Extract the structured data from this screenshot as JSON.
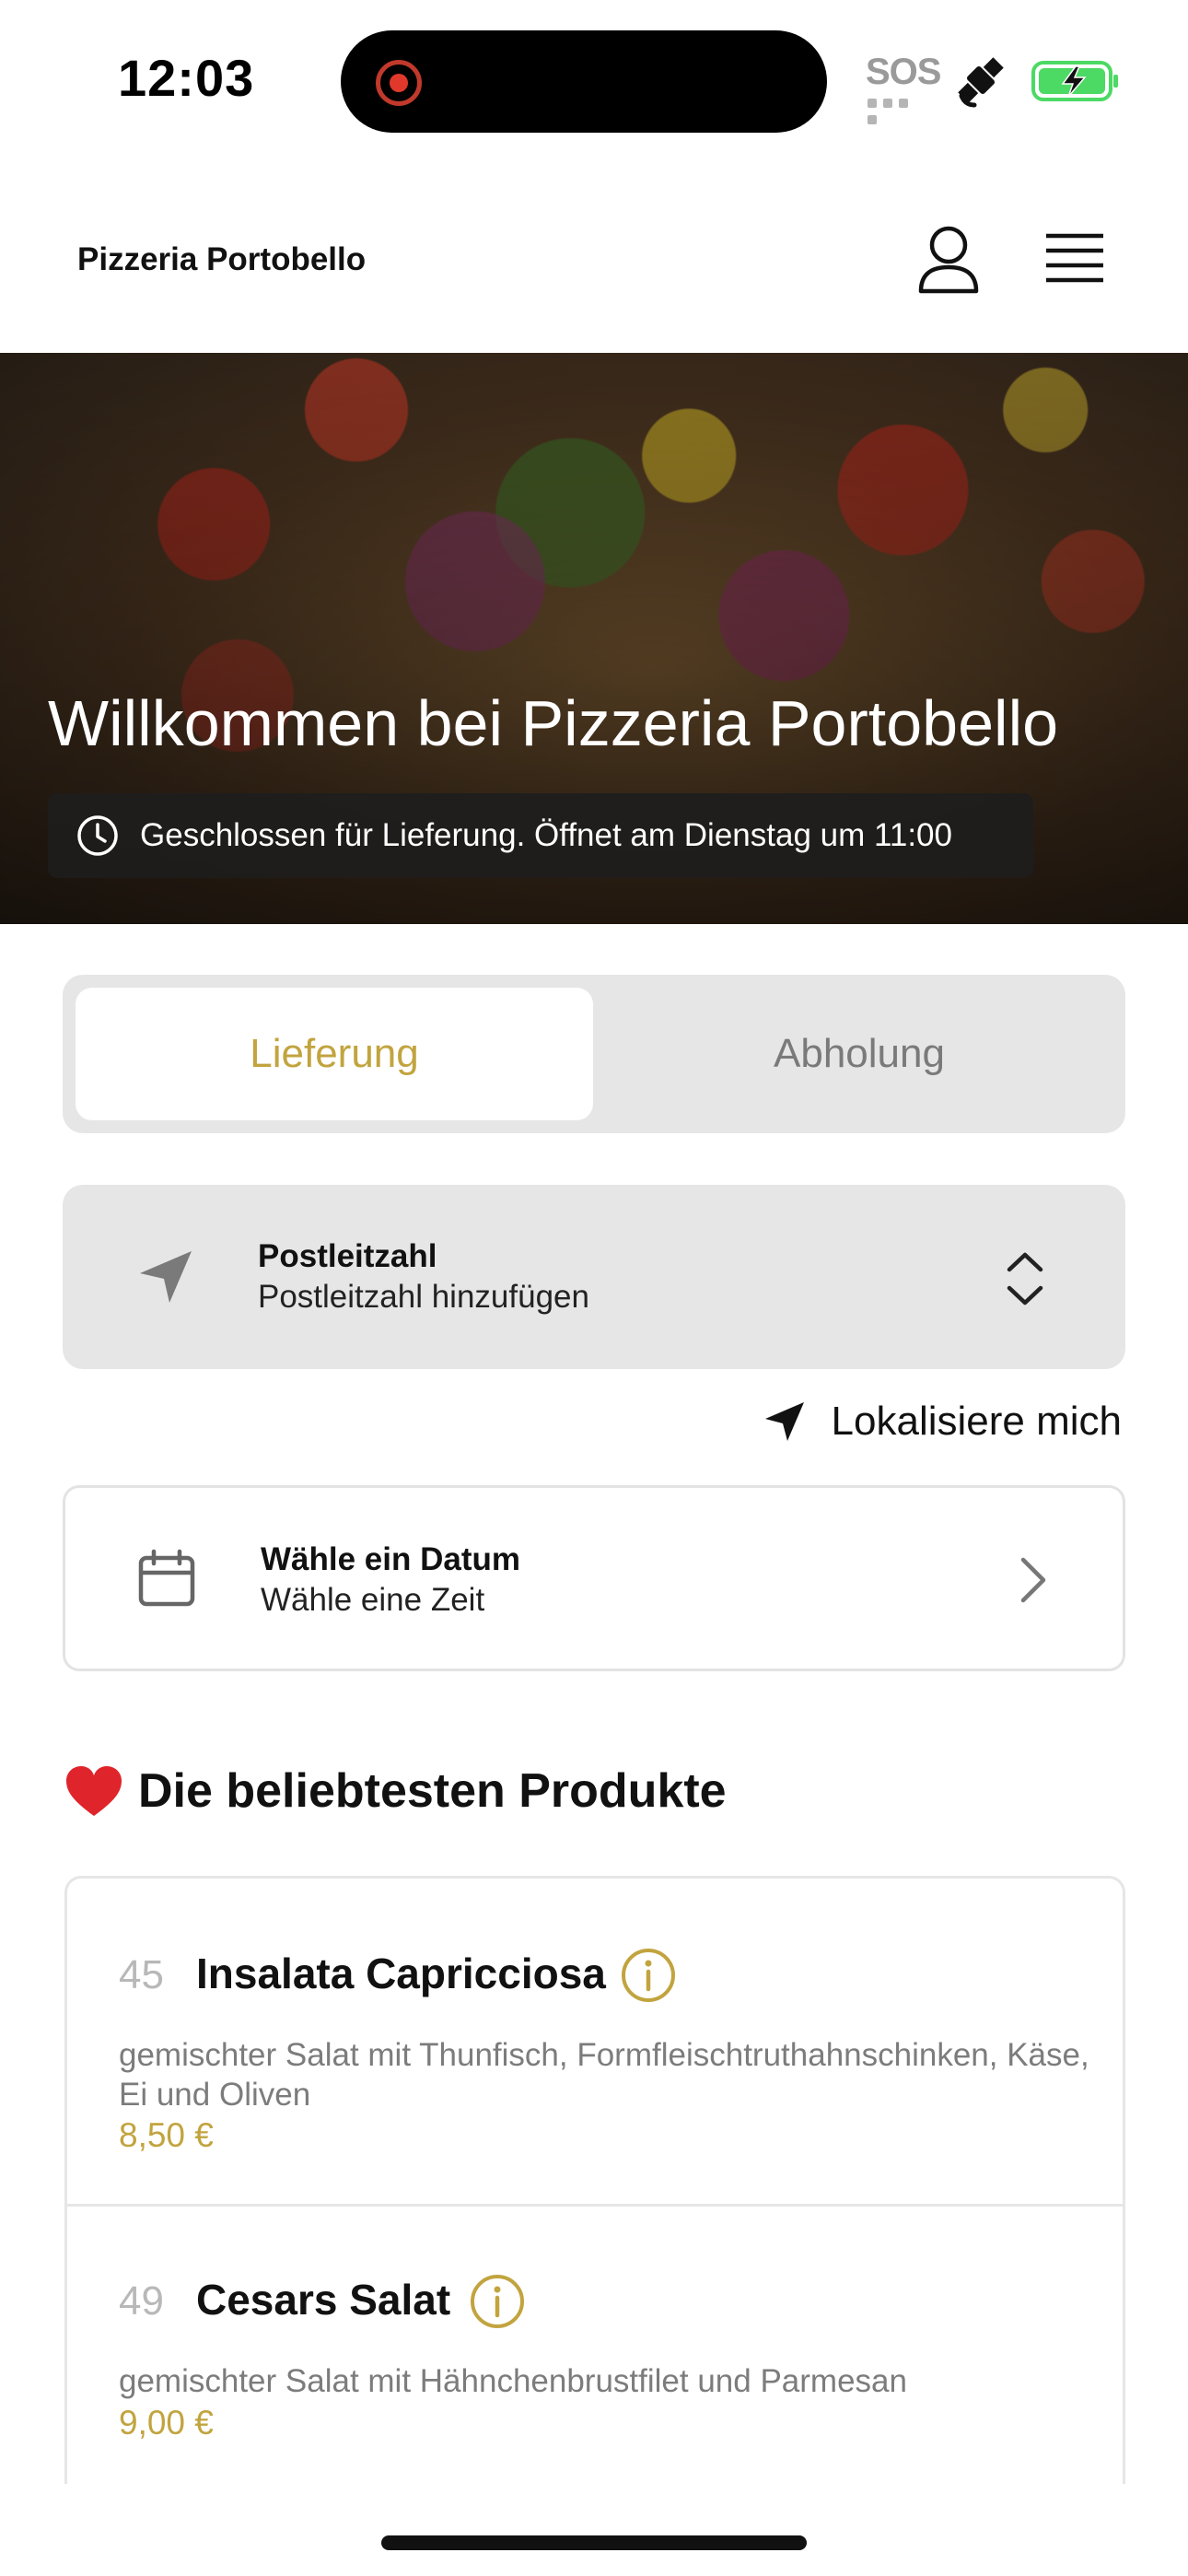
{
  "status_bar": {
    "time": "12:03",
    "sos": "SOS"
  },
  "header": {
    "title": "Pizzeria Portobello"
  },
  "hero": {
    "title": "Willkommen bei Pizzeria Portobello",
    "notice": "Geschlossen für Lieferung. Öffnet am Dienstag um 11:00"
  },
  "mode": {
    "delivery": "Lieferung",
    "pickup": "Abholung",
    "selected": "Lieferung"
  },
  "postcode": {
    "label": "Postleitzahl",
    "value": "Postleitzahl hinzufügen"
  },
  "locate": {
    "label": "Lokalisiere mich"
  },
  "schedule": {
    "date": "Wähle ein Datum",
    "time": "Wähle eine Zeit"
  },
  "popular": {
    "title": "Die beliebtesten Produkte",
    "items": [
      {
        "number": "45",
        "name": "Insalata Capricciosa",
        "description": "gemischter Salat mit Thunfisch, Formfleischtruthahnschinken, Käse, Ei und Oliven",
        "price": "8,50 €"
      },
      {
        "number": "49",
        "name": "Cesars Salat",
        "description": "gemischter Salat mit Hähnchenbrustfilet und Parmesan",
        "price": "9,00 €"
      }
    ]
  },
  "colors": {
    "accent": "#c2a43f",
    "card_bg": "#e6e6e6",
    "heart": "#e0242b"
  }
}
